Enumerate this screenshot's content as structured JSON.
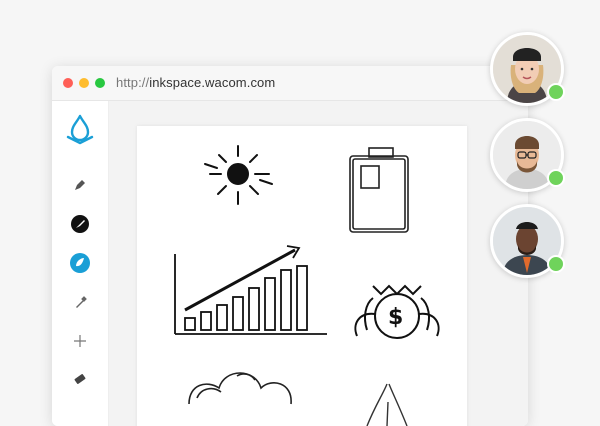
{
  "browser": {
    "url_protocol": "http://",
    "url_host": "inkspace.wacom.com"
  },
  "sidebar": {
    "items": [
      {
        "icon": "inkspace-logo-icon"
      },
      {
        "icon": "pen-nib-icon"
      },
      {
        "icon": "brush-icon"
      },
      {
        "icon": "ink-drop-icon"
      },
      {
        "icon": "marker-icon"
      },
      {
        "icon": "move-icon"
      },
      {
        "icon": "eraser-icon"
      }
    ]
  },
  "canvas": {
    "sketches": [
      "sun-sketch",
      "battery-sketch",
      "bar-chart-sketch",
      "money-bag-sketch",
      "cloud-sketch",
      "rocket-sketch"
    ]
  },
  "collaborators": [
    {
      "name": "collaborator-1",
      "status": "online",
      "status_color": "#6fd35b"
    },
    {
      "name": "collaborator-2",
      "status": "online",
      "status_color": "#6fd35b"
    },
    {
      "name": "collaborator-3",
      "status": "online",
      "status_color": "#6fd35b"
    }
  ],
  "colors": {
    "accent": "#1a9fd6",
    "online": "#6fd35b"
  }
}
